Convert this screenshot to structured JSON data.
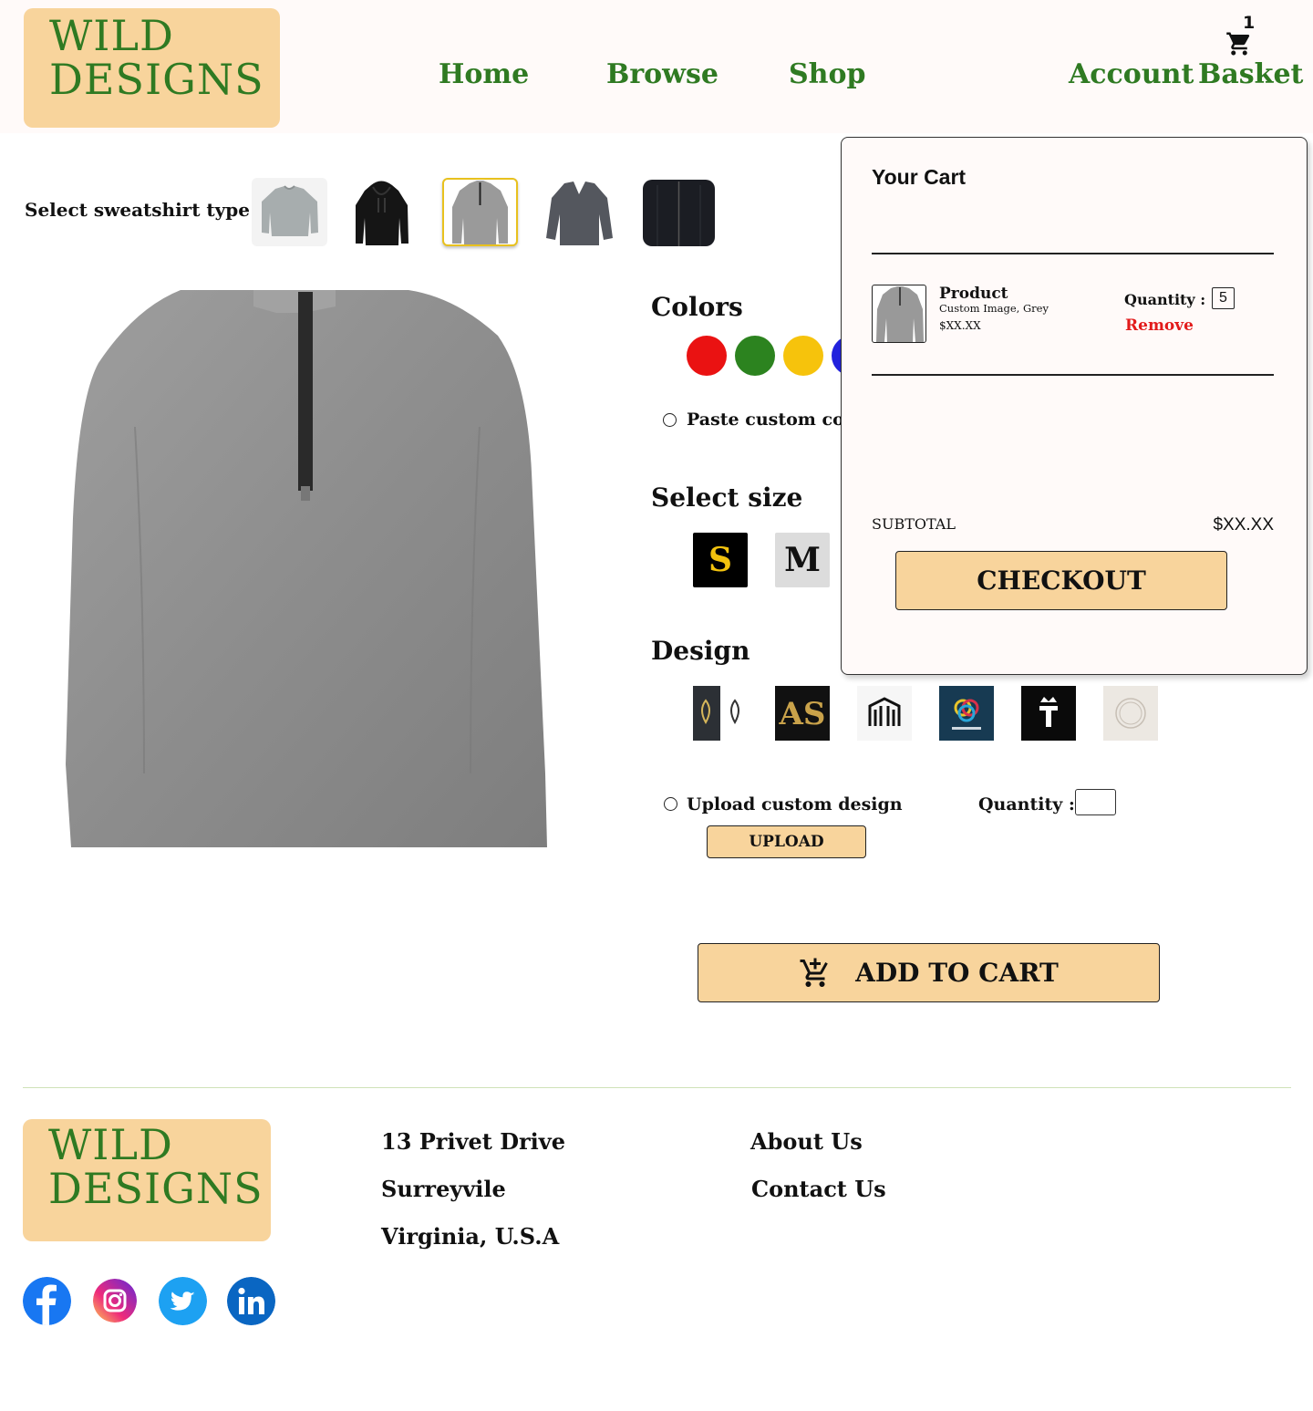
{
  "brand": {
    "line1": "WILD",
    "line2": "DESIGNS"
  },
  "nav": {
    "home": "Home",
    "browse": "Browse",
    "shop": "Shop",
    "account": "Account",
    "basket": "Basket",
    "cart_count": "1"
  },
  "type_select": {
    "label": "Select sweatshirt type",
    "selected_index": 2
  },
  "colors": {
    "title": "Colors",
    "swatches": [
      "#ea1212",
      "#2c831f",
      "#f6c30c",
      "#2222dd"
    ],
    "custom_label": "Paste custom color"
  },
  "size": {
    "title": "Select size",
    "options": [
      "S",
      "M"
    ],
    "selected": "S"
  },
  "design": {
    "title": "Design"
  },
  "upload": {
    "radio_label": "Upload custom design",
    "button": "UPLOAD",
    "quantity_label": "Quantity :"
  },
  "add_to_cart": {
    "label": "ADD TO CART"
  },
  "cart": {
    "title": "Your Cart",
    "item": {
      "name": "Product",
      "desc": "Custom Image, Grey",
      "price": "$XX.XX",
      "quantity_label": "Quantity :",
      "quantity": "5",
      "remove": "Remove"
    },
    "subtotal_label": "SUBTOTAL",
    "subtotal_value": "$XX.XX",
    "checkout": "CHECKOUT"
  },
  "footer": {
    "address": [
      "13 Privet Drive",
      "Surreyvile",
      "Virginia, U.S.A"
    ],
    "links": [
      "About Us",
      "Contact Us"
    ]
  },
  "colors_theme": {
    "accent": "#f8d49c",
    "brand_green": "#2f7a22",
    "remove_red": "#e21b1b"
  },
  "icons": [
    "cart-icon",
    "add-cart-icon",
    "facebook-icon",
    "instagram-icon",
    "twitter-icon",
    "linkedin-icon"
  ]
}
